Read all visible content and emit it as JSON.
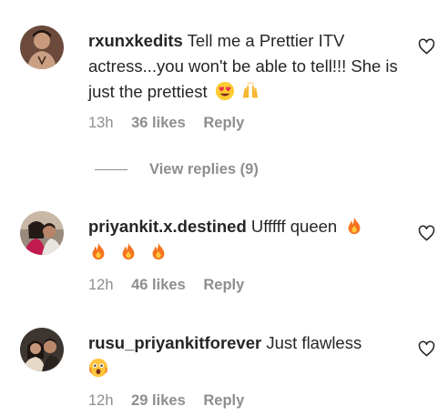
{
  "comments": [
    {
      "username": "rxunxkedits",
      "text": "Tell me a Prettier ITV actress...you won't be able to tell!!! She is just the prettiest",
      "emojis": [
        "heart-eyes-emoji",
        "raising-hands-emoji"
      ],
      "time": "13h",
      "likes": "36 likes",
      "reply": "Reply",
      "view_replies": "View replies (9)"
    },
    {
      "username": "priyankit.x.destined",
      "text": "Ufffff queen",
      "emojis": [
        "fire-emoji",
        "fire-emoji",
        "fire-emoji",
        "fire-emoji"
      ],
      "time": "12h",
      "likes": "46 likes",
      "reply": "Reply"
    },
    {
      "username": "rusu_priyankitforever",
      "text": "Just flawless",
      "emojis": [
        "astonished-emoji"
      ],
      "time": "12h",
      "likes": "29 likes",
      "reply": "Reply"
    }
  ],
  "icons": {
    "like": "heart-outline-icon"
  },
  "colors": {
    "text": "#262626",
    "muted": "#8e8e8e"
  }
}
